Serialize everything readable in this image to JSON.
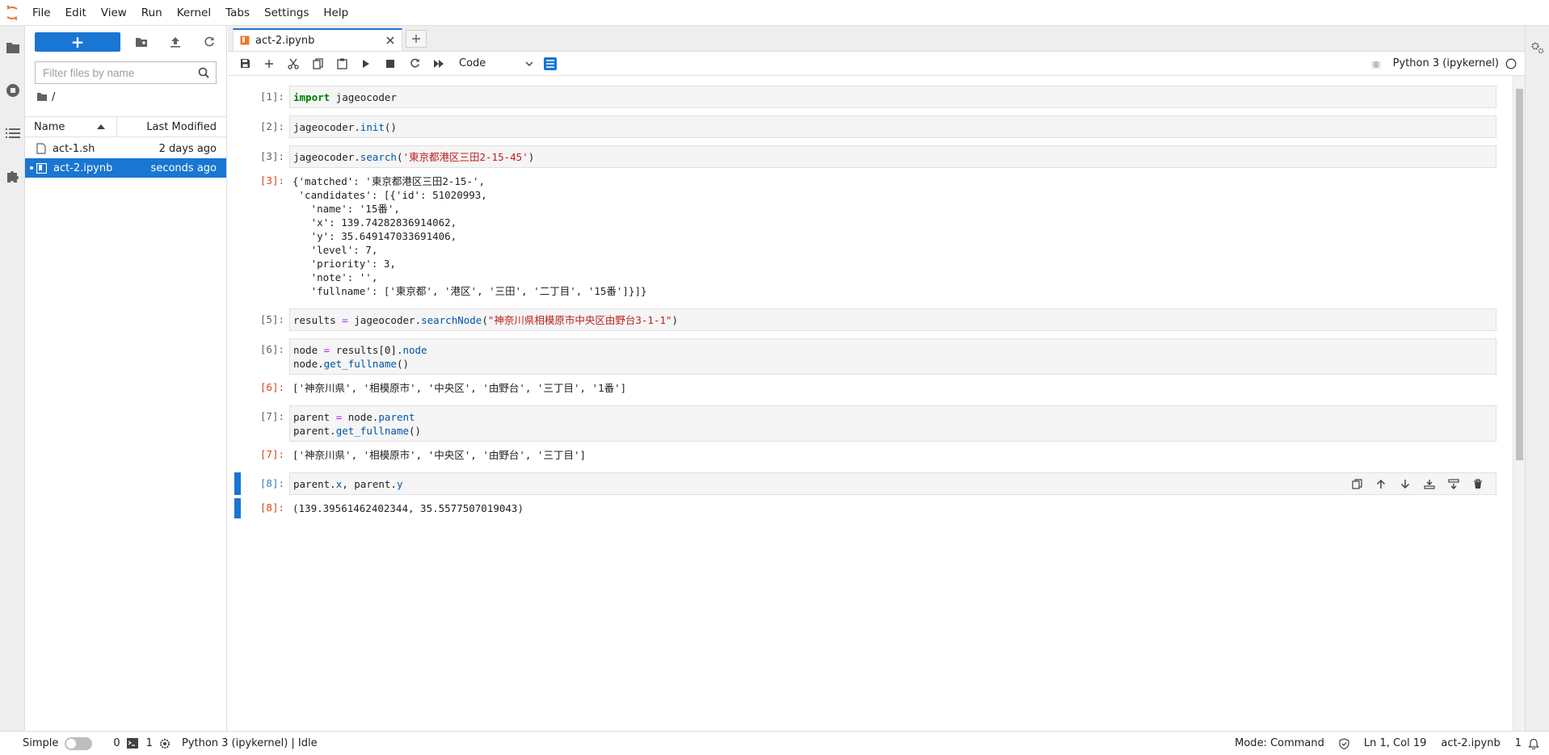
{
  "menu": [
    "File",
    "Edit",
    "View",
    "Run",
    "Kernel",
    "Tabs",
    "Settings",
    "Help"
  ],
  "filebrowser": {
    "new_label": "+",
    "filter_placeholder": "Filter files by name",
    "breadcrumb": "/",
    "col_name": "Name",
    "col_modified": "Last Modified",
    "files": [
      {
        "name": "act-1.sh",
        "modified": "2 days ago"
      },
      {
        "name": "act-2.ipynb",
        "modified": "seconds ago"
      }
    ]
  },
  "tab": {
    "label": "act-2.ipynb"
  },
  "toolbar": {
    "cell_type": "Code",
    "kernel": "Python 3 (ipykernel)"
  },
  "cells": {
    "c1": {
      "prompt": "[1]:",
      "kw": "import",
      "rest": " jageocoder"
    },
    "c2": {
      "prompt": "[2]:",
      "obj": "jageocoder.",
      "fn": "init",
      "rest": "()"
    },
    "c3": {
      "prompt": "[3]:",
      "obj": "jageocoder.",
      "fn": "search",
      "open": "(",
      "str": "'東京都港区三田2-15-45'",
      "close": ")"
    },
    "o3": {
      "prompt": "[3]:",
      "text": "{'matched': '東京都港区三田2-15-',\n 'candidates': [{'id': 51020993,\n   'name': '15番',\n   'x': 139.74282836914062,\n   'y': 35.649147033691406,\n   'level': 7,\n   'priority': 3,\n   'note': '',\n   'fullname': ['東京都', '港区', '三田', '二丁目', '15番']}]}"
    },
    "c5": {
      "prompt": "[5]:",
      "a": "results ",
      "eq": "=",
      "b": " jageocoder.",
      "fn": "searchNode",
      "open": "(",
      "str": "\"神奈川県相模原市中央区由野台3-1-1\"",
      "close": ")"
    },
    "c6": {
      "prompt": "[6]:",
      "l1a": "node ",
      "eq": "=",
      "l1b": " results[0].",
      "l1attr": "node",
      "l2a": "node.",
      "l2fn": "get_fullname",
      "l2b": "()"
    },
    "o6": {
      "prompt": "[6]:",
      "text": "['神奈川県', '相模原市', '中央区', '由野台', '三丁目', '1番']"
    },
    "c7": {
      "prompt": "[7]:",
      "l1a": "parent ",
      "eq": "=",
      "l1b": " node.",
      "l1attr": "parent",
      "l2a": "parent.",
      "l2fn": "get_fullname",
      "l2b": "()"
    },
    "o7": {
      "prompt": "[7]:",
      "text": "['神奈川県', '相模原市', '中央区', '由野台', '三丁目']"
    },
    "c8": {
      "prompt": "[8]:",
      "a": "parent.",
      "attr1": "x",
      "b": ", parent.",
      "attr2": "y"
    },
    "o8": {
      "prompt": "[8]:",
      "text": "(139.39561462402344, 35.5577507019043)"
    }
  },
  "status": {
    "simple": "Simple",
    "terminals": "0",
    "kernels": "1",
    "kernel_status": "Python 3 (ipykernel) | Idle",
    "mode": "Mode: Command",
    "position": "Ln 1, Col 19",
    "filename": "act-2.ipynb",
    "notifications": "1"
  }
}
